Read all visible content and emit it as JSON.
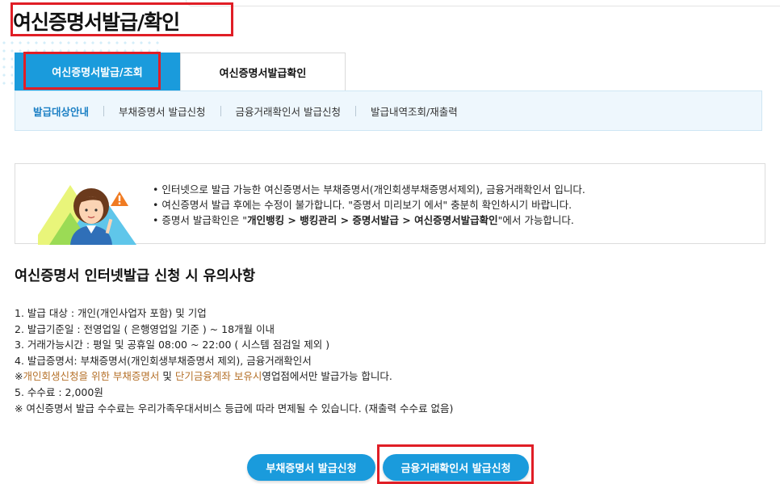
{
  "page_title": "여신증명서발급/확인",
  "tabs": [
    {
      "label": "여신증명서발급/조회",
      "active": true
    },
    {
      "label": "여신증명서발급확인",
      "active": false
    }
  ],
  "subnav": [
    {
      "label": "발급대상안내",
      "active": true
    },
    {
      "label": "부채증명서 발급신청",
      "active": false
    },
    {
      "label": "금융거래확인서 발급신청",
      "active": false
    },
    {
      "label": "발급내역조회/재출력",
      "active": false
    }
  ],
  "notice": {
    "line1": "인터넷으로 발급 가능한 여신증명서는 부채증명서(개인회생부채증명서제외), 금융거래확인서 입니다.",
    "line2": "여신증명서 발급 후에는 수정이 불가합니다. \"증명서 미리보기 에서\" 충분히 확인하시기 바랍니다.",
    "line3_prefix": "증명서 발급확인은 \"",
    "line3_path": "개인뱅킹 > 뱅킹관리 > 증명서발급 > 여신증명서발급확인",
    "line3_suffix": "\"에서 가능합니다."
  },
  "section_title": "여신증명서 인터넷발급 신청 시 유의사항",
  "rules": {
    "r1": "1. 발급 대상 : 개인(개인사업자 포함) 및 기업",
    "r2": "2. 발급기준일 : 전영업일 ( 은행영업일 기준 ) ~ 18개월 이내",
    "r3": "3. 거래가능시간 : 평일 및 공휴일 08:00 ~ 22:00 ( 시스템 점검일 제외 )",
    "r4": "4. 발급증명서: 부채증명서(개인회생부채증명서 제외), 금융거래확인서",
    "r4_note_prefix": "※",
    "r4_note_orange1": "개인회생신청을 위한 부채증명서",
    "r4_note_mid": " 및 ",
    "r4_note_orange2": "단기금융계좌 보유시",
    "r4_note_suffix": "영업점에서만 발급가능 합니다.",
    "r5": "5. 수수료 : 2,000원",
    "r5_note": "※ 여신증명서 발급 수수료는 우리가족우대서비스 등급에 따라 면제될 수 있습니다. (재출력 수수료 없음)"
  },
  "buttons": {
    "debt": "부채증명서 발급신청",
    "financial": "금융거래확인서 발급신청"
  },
  "colors": {
    "accent": "#1a9bdc",
    "highlight_box": "#e01e26",
    "note_orange": "#b5712a"
  }
}
